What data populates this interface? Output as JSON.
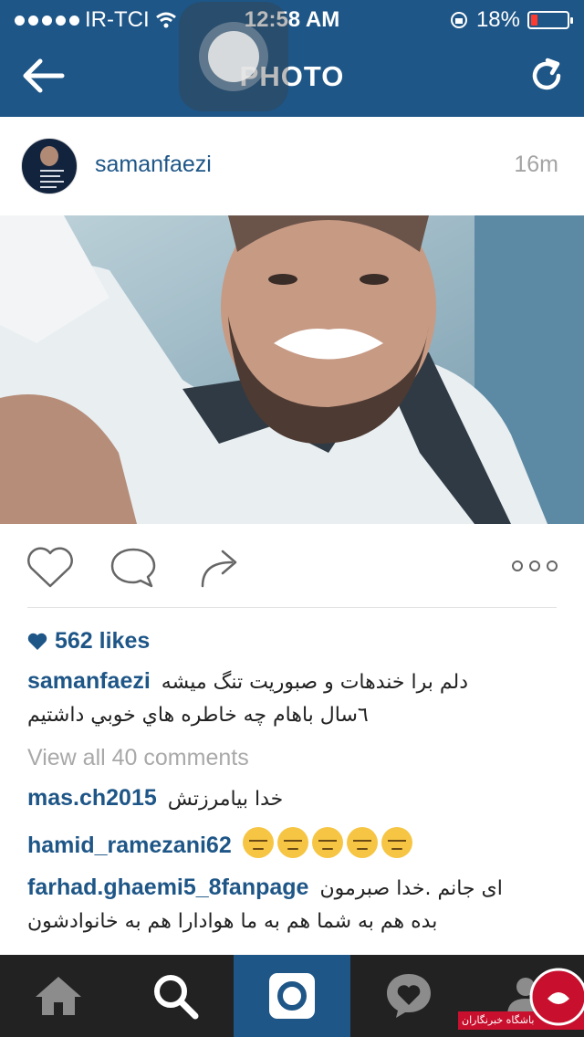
{
  "status_bar": {
    "carrier": "IR-TCI",
    "time": "12:58 AM",
    "battery": "18%",
    "battery_level": 0.18
  },
  "header": {
    "title": "PHOTO"
  },
  "post": {
    "username": "samanfaezi",
    "time_ago": "16m",
    "likes": "562 likes",
    "caption_line1": "دلم برا خندهات و صبوريت تنگ ميشه",
    "caption_line2": "٦سال باهام چه خاطره هاي خوبي داشتيم",
    "view_all": "View all 40 comments",
    "comments": [
      {
        "username": "mas.ch2015",
        "text": "خدا بيامرزتش"
      },
      {
        "username": "hamid_ramezani62",
        "text": ""
      },
      {
        "username": "farhad.ghaemi5_8fanpage",
        "text": "اى جانم .خدا صبرمون",
        "text2": "بده هم به شما هم به ما هوادارا هم به خانوادشون"
      }
    ]
  },
  "watermark": {
    "text": "باشگاه خبرنگاران"
  },
  "colors": {
    "brand": "#1e5687",
    "tabbar": "#222222"
  },
  "icons": [
    "back-arrow-icon",
    "refresh-icon",
    "heart-icon",
    "comment-icon",
    "share-icon",
    "more-icon",
    "home-icon",
    "search-icon",
    "camera-icon",
    "activity-icon",
    "profile-icon"
  ]
}
